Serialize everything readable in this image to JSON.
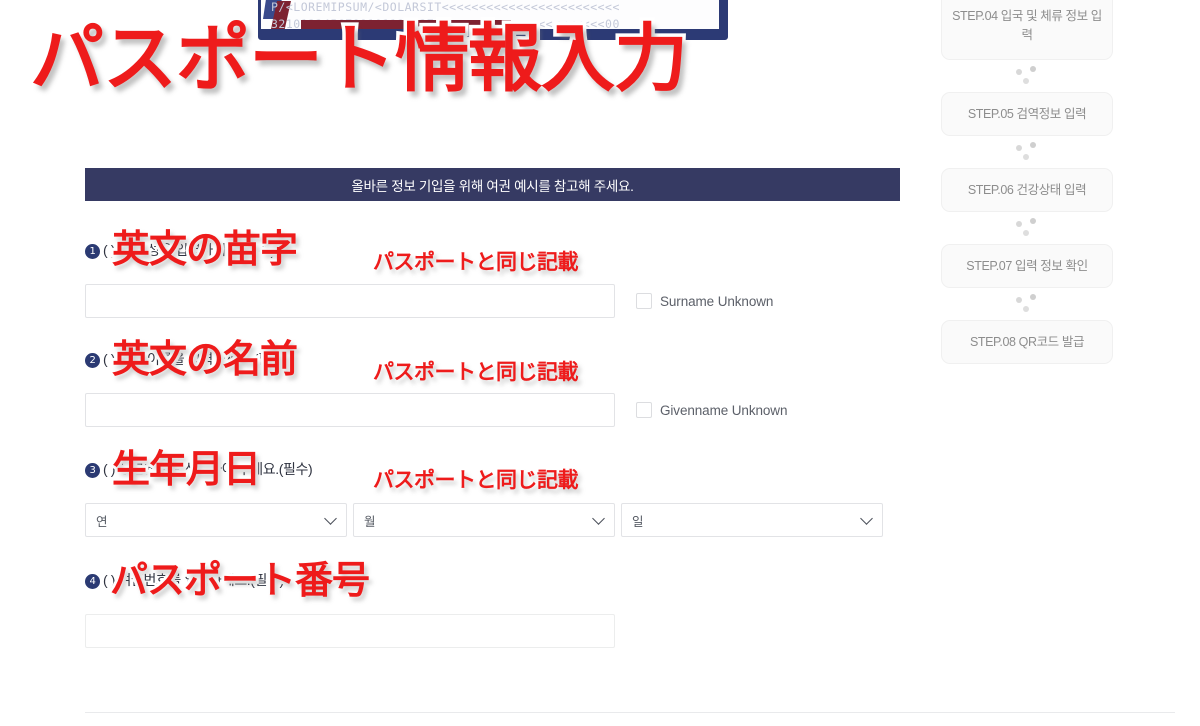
{
  "overlay": {
    "title": "パスポート情報入力",
    "annotations": [
      {
        "big": "英文の苗字",
        "small": "パスポートと同じ記載"
      },
      {
        "big": "英文の名前",
        "small": "パスポートと同じ記載"
      },
      {
        "big": "生年月日",
        "small": "パスポートと同じ記載"
      },
      {
        "big": "パスポート番号",
        "small": ""
      }
    ]
  },
  "passport_sample": {
    "mrz_line1": "P/<LOREMIPSUM/<DOLARSIT<<<<<<<<<<<<<<<<<<<<<<<<",
    "mrz_line2": "3210123456789101112137<<<<<<<<<<<<<<<<<<<<<<<00"
  },
  "notice": {
    "text": "올바른 정보 기입을 위해 여권 예시를 참고해 주세요."
  },
  "fields": [
    {
      "number": "1",
      "label": "( ) 영문 성을 입력하세요.(필수)",
      "input_value": "",
      "input_placeholder": "",
      "checkbox_label": "Surname Unknown",
      "checkbox_checked": false
    },
    {
      "number": "2",
      "label": "( ) 영문 이름을 입력하세요.(필수)",
      "input_value": "",
      "input_placeholder": "",
      "checkbox_label": "Givenname Unknown",
      "checkbox_checked": false
    },
    {
      "number": "3",
      "label": "( ) 생년월일을 선택하여 주세요.(필수)",
      "selects": [
        {
          "value": "연"
        },
        {
          "value": "월"
        },
        {
          "value": "일"
        }
      ]
    },
    {
      "number": "4",
      "label": "( ) 여권번호를 입력하세요.(필수)",
      "input_value": "",
      "input_placeholder": ""
    }
  ],
  "steps": [
    {
      "label": "STEP.04 입국 및 체류 정보 입력",
      "tall": true
    },
    {
      "label": "STEP.05 검역정보 입력",
      "tall": false
    },
    {
      "label": "STEP.06 건강상태 입력",
      "tall": false
    },
    {
      "label": "STEP.07 입력 정보 확인",
      "tall": false
    },
    {
      "label": "STEP.08 QR코드 발급",
      "tall": false
    }
  ],
  "colors": {
    "notice_bar": "#363a63",
    "bullet": "#2b3a73",
    "annotation_red": "#ee1b1b",
    "passport_navy": "#2c3a75",
    "passport_maroon": "#7d2231"
  }
}
